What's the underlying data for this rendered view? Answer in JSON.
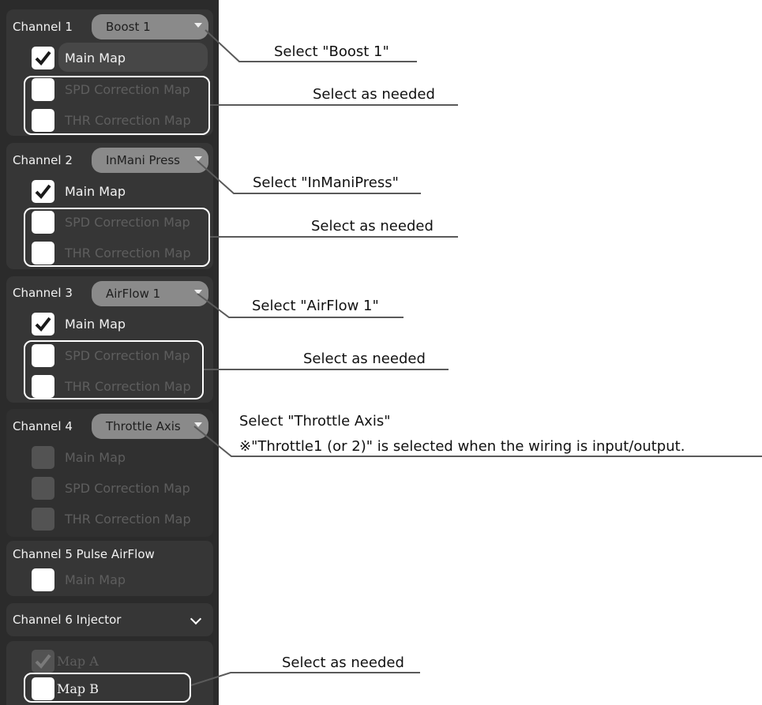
{
  "colors": {
    "panel_bg": "#2b2b2b",
    "group_bg": "#363636",
    "combo_bg": "#8a8a8a",
    "annotation_line": "#5a5a5a"
  },
  "channels": [
    {
      "title": "Channel 1",
      "combo": "Boost 1",
      "options": {
        "main": "Main Map",
        "spd": "SPD Correction Map",
        "thr": "THR Correction Map"
      }
    },
    {
      "title": "Channel 2",
      "combo": "InMani Press",
      "options": {
        "main": "Main Map",
        "spd": "SPD Correction Map",
        "thr": "THR Correction Map"
      }
    },
    {
      "title": "Channel 3",
      "combo": "AirFlow 1",
      "options": {
        "main": "Main Map",
        "spd": "SPD Correction Map",
        "thr": "THR Correction Map"
      }
    },
    {
      "title": "Channel 4",
      "combo": "Throttle Axis",
      "options": {
        "main": "Main Map",
        "spd": "SPD Correction Map",
        "thr": "THR Correction Map"
      }
    },
    {
      "title": "Channel 5 Pulse AirFlow",
      "options": {
        "main": "Main Map"
      }
    },
    {
      "title": "Channel 6 Injector",
      "options": {
        "a": "Map A",
        "b": "Map B"
      }
    }
  ],
  "annotations": {
    "ch1_select": "Select \"Boost 1\"",
    "ch1_as_needed": "Select as needed",
    "ch2_select": "Select \"InManiPress\"",
    "ch2_as_needed": "Select as needed",
    "ch3_select": "Select \"AirFlow 1\"",
    "ch3_as_needed": "Select as needed",
    "ch4_select": "Select \"Throttle Axis\"",
    "ch4_note": "※\"Throttle1 (or 2)\" is selected when the wiring is input/output.",
    "ch6_as_needed": "Select as needed"
  }
}
